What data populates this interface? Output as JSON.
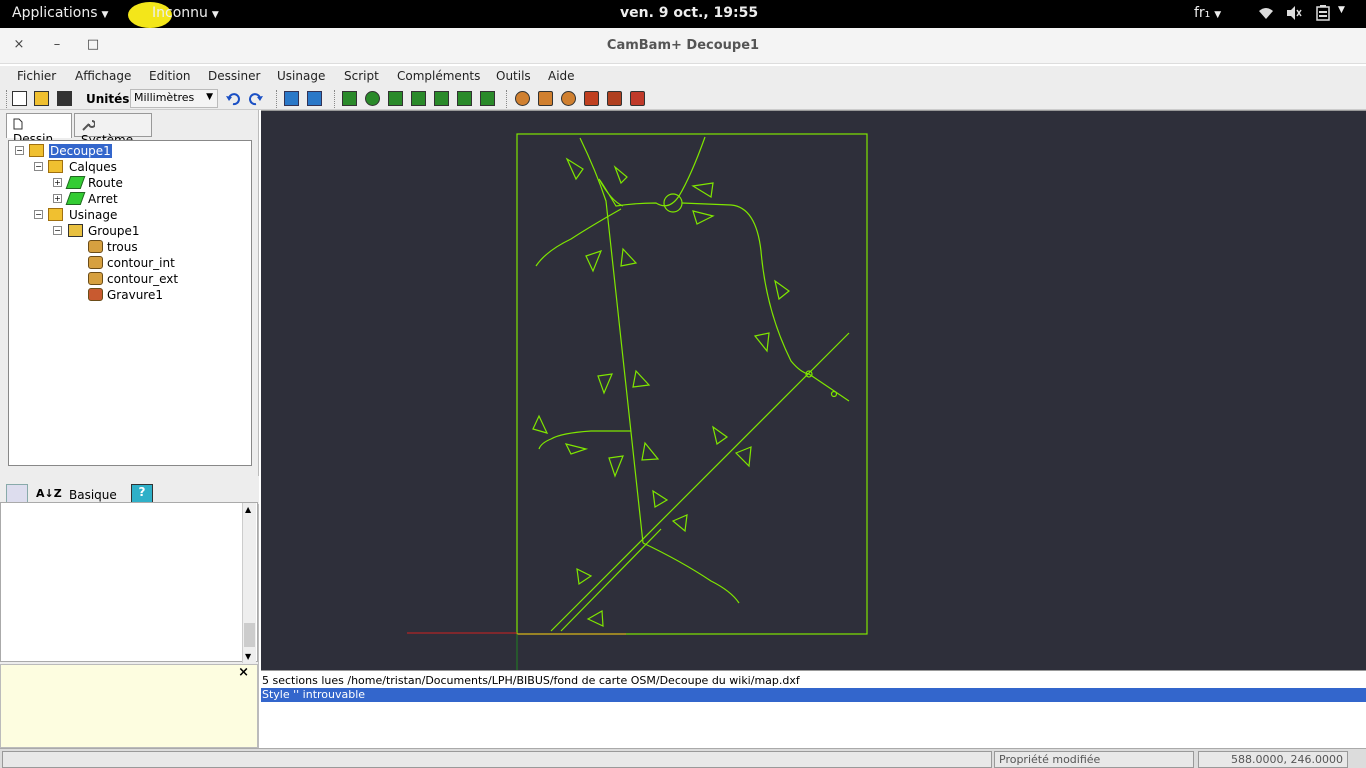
{
  "system_bar": {
    "applications": "Applications",
    "app_menu": "Inconnu",
    "clock": "ven.  9 oct., 19:55",
    "keyboard": "fr₁"
  },
  "window": {
    "title": "CamBam+  Decoupe1",
    "close": "×",
    "minimize": "–",
    "maximize": "□"
  },
  "menu": [
    "Fichier",
    "Affichage",
    "Edition",
    "Dessiner",
    "Usinage",
    "Script",
    "Compléments",
    "Outils",
    "Aide"
  ],
  "toolbar": {
    "units_label": "Unités",
    "units_value": "Millimètres"
  },
  "left_tabs": {
    "drawing": "Dessin",
    "system": "Système"
  },
  "tree": {
    "root": "Decoupe1",
    "layers": "Calques",
    "layer_route": "Route",
    "layer_arret": "Arret",
    "machining": "Usinage",
    "group": "Groupe1",
    "op1": "trous",
    "op2": "contour_int",
    "op3": "contour_ext",
    "op4": "Gravure1"
  },
  "props": {
    "mode": "Basique",
    "help": "?"
  },
  "log": {
    "line1": "5 sections lues /home/tristan/Documents/LPH/BIBUS/fond de carte OSM/Decoupe du wiki/map.dxf",
    "line2": "Style '' introuvable"
  },
  "status": {
    "message": "Propriété modifiée",
    "coords": "588.0000, 246.0000"
  },
  "colors": {
    "canvas_bg": "#2e2f3a",
    "drawing": "#7fe600",
    "selection": "#3366cc"
  }
}
